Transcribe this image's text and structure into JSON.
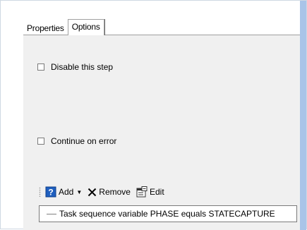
{
  "tabs": [
    {
      "label": "Properties",
      "active": false
    },
    {
      "label": "Options",
      "active": true
    }
  ],
  "options": {
    "disable_step": {
      "label": "Disable this step",
      "checked": false
    },
    "continue_on_error": {
      "label": "Continue on error",
      "checked": false
    }
  },
  "toolbar": {
    "add_label": "Add",
    "remove_label": "Remove",
    "edit_label": "Edit",
    "icons": [
      "help-icon",
      "chevron-down-icon",
      "remove-x-icon",
      "edit-properties-icon"
    ]
  },
  "conditions": [
    {
      "text": "Task sequence variable PHASE equals STATECAPTURE"
    }
  ],
  "colors": {
    "panel_bg": "#f0f0f0",
    "accent_edge": "#a9c4e8",
    "help_icon_blue": "#1f5fbf"
  }
}
